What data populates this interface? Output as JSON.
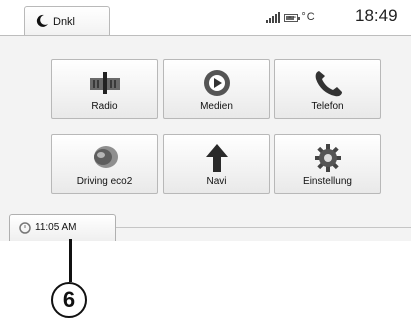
{
  "top": {
    "tab_label": "Dnkl",
    "temperature": "-- °C",
    "time": "18:49"
  },
  "tiles": [
    {
      "label": "Radio",
      "icon": "radio-icon"
    },
    {
      "label": "Medien",
      "icon": "media-play-icon"
    },
    {
      "label": "Telefon",
      "icon": "phone-icon"
    },
    {
      "label": "Driving eco2",
      "icon": "leaf-eco-icon"
    },
    {
      "label": "Navi",
      "icon": "navigation-arrow-icon"
    },
    {
      "label": "Einstellung",
      "icon": "gear-icon"
    }
  ],
  "bottom": {
    "clock_time": "11:05 AM"
  },
  "callout": {
    "number": "6"
  },
  "colors": {
    "panel": "#f3f3f3",
    "tile_border": "#b8b8b8"
  }
}
